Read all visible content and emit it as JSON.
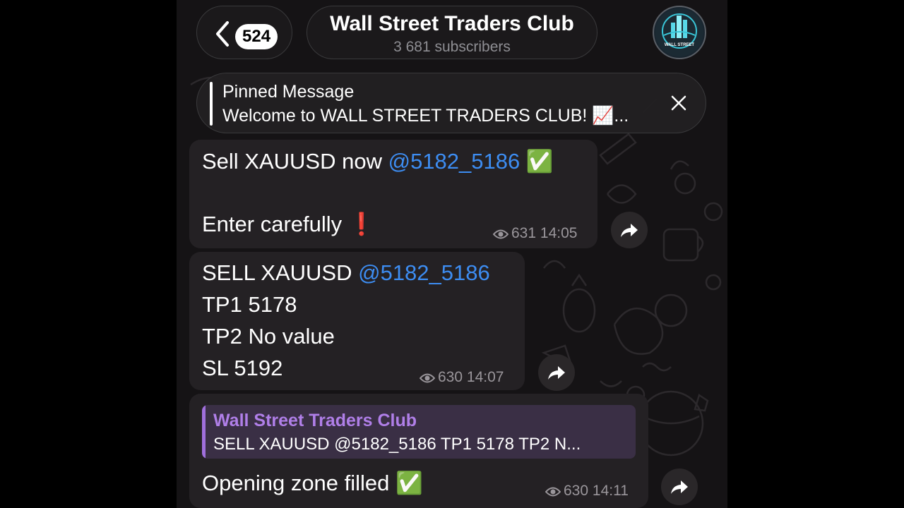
{
  "header": {
    "back_count": "524",
    "title": "Wall Street Traders Club",
    "subscribers": "3 681 subscribers",
    "avatar_caption": "WALL STREET"
  },
  "pinned": {
    "title": "Pinned Message",
    "text": "Welcome to WALL STREET TRADERS CLUB! 📈..."
  },
  "messages": [
    {
      "line1_prefix": "Sell XAUUSD now ",
      "line1_mention": "@5182_5186",
      "line1_emoji": "✅",
      "line2_text": "Enter carefully ",
      "line2_emoji": "❗",
      "views": "631",
      "time": "14:05"
    },
    {
      "line1_prefix": "SELL XAUUSD ",
      "line1_mention": "@5182_5186",
      "line2": "TP1 5178",
      "line3": "TP2 No value",
      "line4": "SL 5192",
      "views": "630",
      "time": "14:07"
    },
    {
      "reply_name": "Wall Street Traders Club",
      "reply_text": "SELL XAUUSD @5182_5186 TP1 5178 TP2 N...",
      "text": "Opening zone filled ",
      "emoji": "✅",
      "views": "630",
      "time": "14:11"
    }
  ],
  "colors": {
    "mention": "#3d8df2",
    "reply_accent": "#a06fdc",
    "bubble": "#242124",
    "check_green": "#45b04a"
  }
}
